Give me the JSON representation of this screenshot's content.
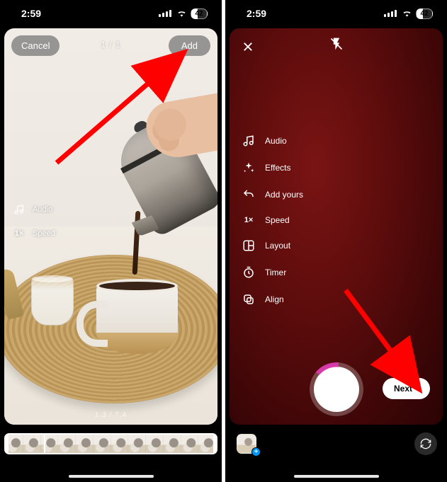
{
  "status": {
    "time": "2:59",
    "battery": "42"
  },
  "left": {
    "cancel": "Cancel",
    "add": "Add",
    "counter": "1 / 1",
    "tool_audio": "Audio",
    "tool_speed_prefix": "1×",
    "tool_speed": "Speed",
    "bottom_counter": "1.3  /  7.4"
  },
  "right": {
    "tool_audio": "Audio",
    "tool_effects": "Effects",
    "tool_addyours": "Add yours",
    "tool_speed_prefix": "1×",
    "tool_speed": "Speed",
    "tool_layout": "Layout",
    "tool_timer": "Timer",
    "tool_align": "Align",
    "next": "Next"
  },
  "colors": {
    "arrow": "#ff0000",
    "accent_blue": "#0095f6",
    "ring_pink": "#d63aa8"
  }
}
